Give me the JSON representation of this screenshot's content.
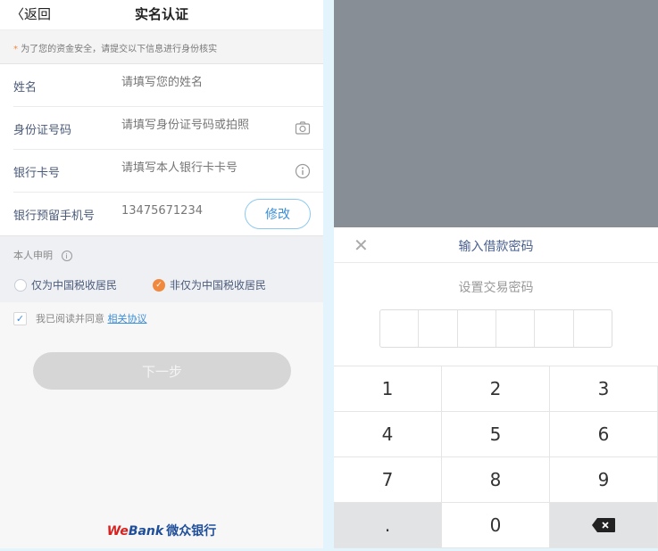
{
  "left": {
    "back_label": "返回",
    "title": "实名认证",
    "notice_star": "*",
    "notice": "为了您的资金安全，请提交以下信息进行身份核实",
    "fields": [
      {
        "label": "姓名",
        "placeholder": "请填写您的姓名"
      },
      {
        "label": "身份证号码",
        "placeholder": "请填写身份证号码或拍照",
        "icon": "camera-icon"
      },
      {
        "label": "银行卡号",
        "placeholder": "请填写本人银行卡卡号",
        "icon": "info-icon"
      },
      {
        "label": "银行预留手机号",
        "value": "13475671234",
        "button": "修改"
      }
    ],
    "declaration": {
      "title": "本人申明",
      "options": [
        "仅为中国税收居民",
        "非仅为中国税收居民"
      ],
      "selected": 1
    },
    "agree_text": "我已阅读并同意",
    "agree_link": "相关协议",
    "agree_checked": true,
    "next_label": "下一步",
    "logo": {
      "we": "We",
      "bank": "Bank",
      "cn": "微众银行"
    }
  },
  "right": {
    "title": "输入借款密码",
    "subtitle": "设置交易密码",
    "password_length": 6,
    "keys": [
      "1",
      "2",
      "3",
      "4",
      "5",
      "6",
      "7",
      "8",
      "9",
      ".",
      "0",
      "backspace"
    ]
  },
  "colors": {
    "accent": "#3d8fd8",
    "orange": "#f0883e",
    "overlay": "#878e96"
  }
}
